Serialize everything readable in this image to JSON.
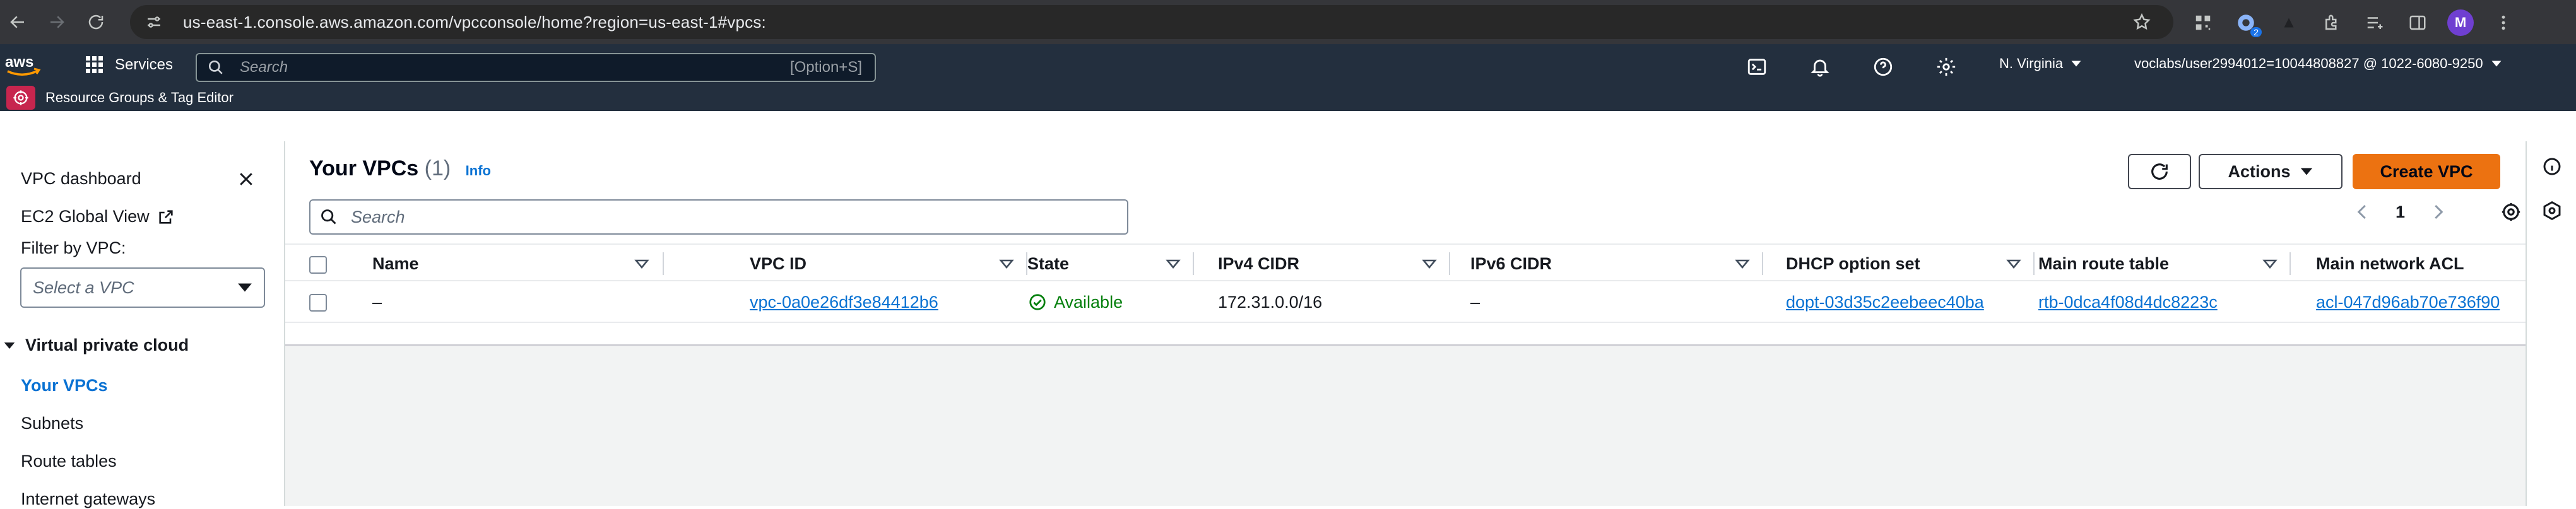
{
  "browser": {
    "url": "us-east-1.console.aws.amazon.com/vpcconsole/home?region=us-east-1#vpcs:",
    "profile_initial": "M",
    "extension_badge": "2"
  },
  "aws_nav": {
    "services_label": "Services",
    "search_placeholder": "Search",
    "search_shortcut": "[Option+S]",
    "region": "N. Virginia",
    "account": "voclabs/user2994012=10044808827 @ 1022-6080-9250",
    "resource_groups_label": "Resource Groups & Tag Editor"
  },
  "sidebar": {
    "dashboard": "VPC dashboard",
    "ec2_global_view": "EC2 Global View",
    "filter_label": "Filter by VPC:",
    "filter_placeholder": "Select a VPC",
    "section_title": "Virtual private cloud",
    "items": [
      "Your VPCs",
      "Subnets",
      "Route tables",
      "Internet gateways"
    ]
  },
  "panel": {
    "title": "Your VPCs",
    "count": "(1)",
    "info": "Info",
    "actions_label": "Actions",
    "create_label": "Create VPC",
    "search_placeholder": "Search",
    "page_number": "1"
  },
  "table": {
    "columns": [
      "Name",
      "VPC ID",
      "State",
      "IPv4 CIDR",
      "IPv6 CIDR",
      "DHCP option set",
      "Main route table",
      "Main network ACL"
    ],
    "rows": [
      {
        "name": "–",
        "vpc_id": "vpc-0a0e26df3e84412b6",
        "state": "Available",
        "ipv4_cidr": "172.31.0.0/16",
        "ipv6_cidr": "–",
        "dhcp_option_set": "dopt-03d35c2eebeec40ba",
        "main_route_table": "rtb-0dca4f08d4dc8223c",
        "main_network_acl": "acl-047d96ab70e736f90"
      }
    ]
  },
  "colors": {
    "nav_bg": "#232f3e",
    "primary_button": "#ec7211",
    "link": "#0972d3",
    "status_ok": "#037f0c"
  }
}
